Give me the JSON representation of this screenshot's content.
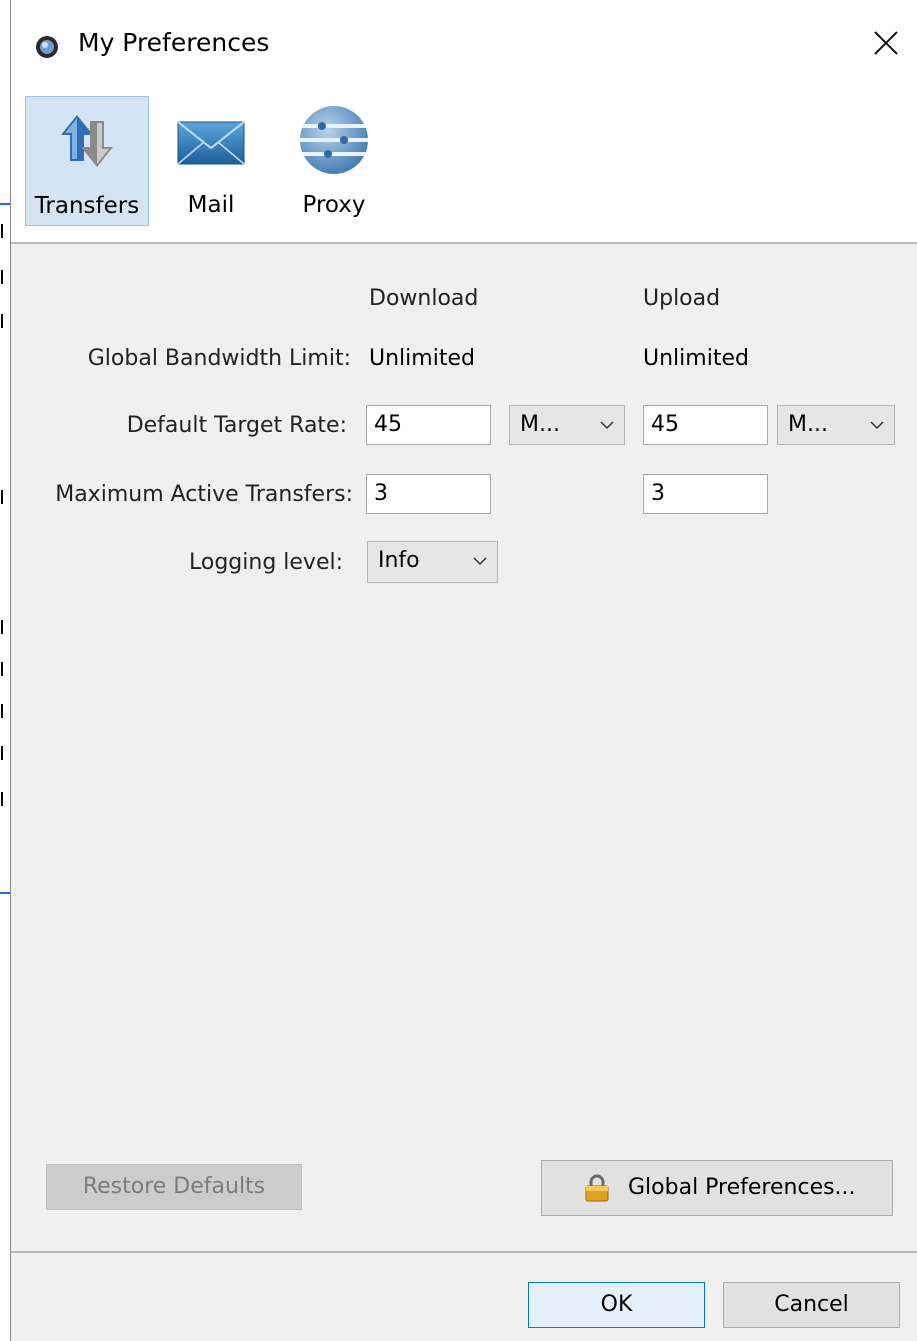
{
  "window": {
    "title": "My Preferences",
    "close_glyph": "✕"
  },
  "toolbar": {
    "items": [
      {
        "label": "Transfers",
        "icon": "transfers-icon",
        "selected": true
      },
      {
        "label": "Mail",
        "icon": "mail-icon",
        "selected": false
      },
      {
        "label": "Proxy",
        "icon": "proxy-icon",
        "selected": false
      }
    ]
  },
  "form": {
    "columns": {
      "download": "Download",
      "upload": "Upload"
    },
    "global_bandwidth": {
      "label": "Global Bandwidth Limit:",
      "download": "Unlimited",
      "upload": "Unlimited"
    },
    "default_target_rate": {
      "label": "Default Target Rate:",
      "download_value": "45",
      "download_unit": "M...",
      "upload_value": "45",
      "upload_unit": "M..."
    },
    "max_active_transfers": {
      "label": "Maximum Active Transfers:",
      "download_value": "3",
      "upload_value": "3"
    },
    "logging_level": {
      "label": "Logging level:",
      "value": "Info"
    }
  },
  "buttons": {
    "restore_defaults": "Restore Defaults",
    "global_preferences": "Global Preferences...",
    "ok": "OK",
    "cancel": "Cancel"
  },
  "colors": {
    "selection_bg": "#d5e4f3",
    "default_button_border": "#0078d7",
    "background_accent": "#1f6fd1"
  }
}
